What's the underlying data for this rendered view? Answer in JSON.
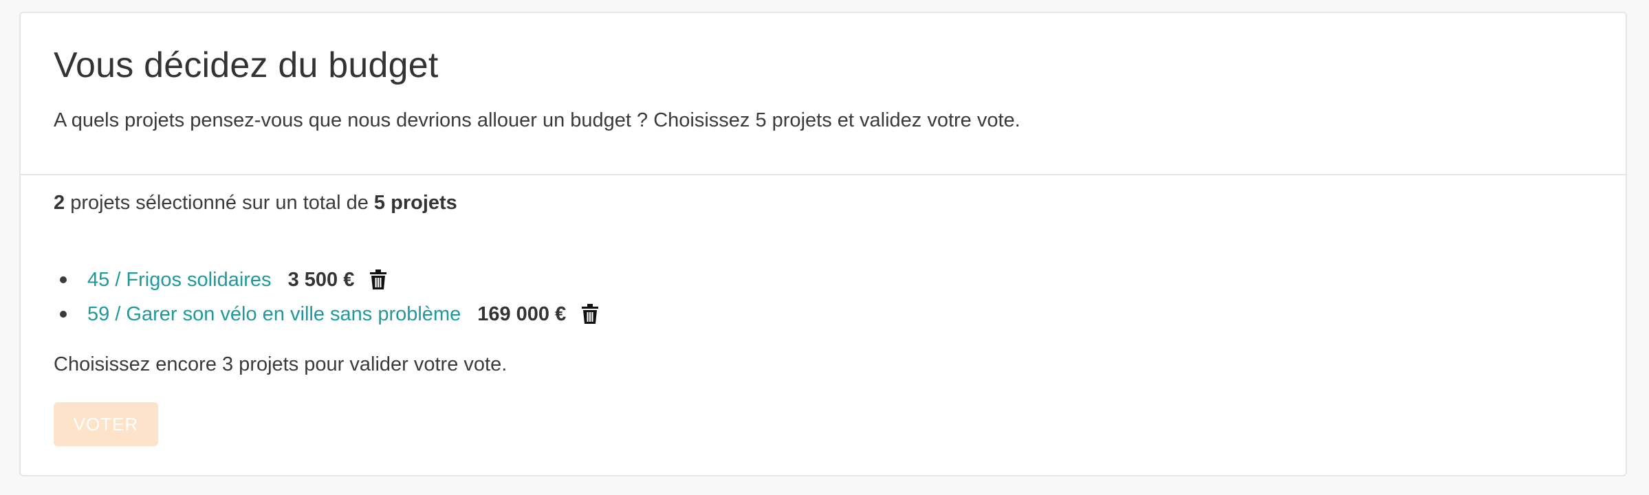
{
  "header": {
    "title": "Vous décidez du budget",
    "description": "A quels projets pensez-vous que nous devrions allouer un budget ? Choisissez 5 projets et validez votre vote."
  },
  "summary": {
    "selected_count": "2",
    "middle_text": " projets sélectionné sur un total de ",
    "total_text": "5 projets"
  },
  "projects": [
    {
      "label": "45 / Frigos solidaires",
      "amount": "3 500 €",
      "remove_icon": "trash-icon"
    },
    {
      "label": "59 / Garer son vélo en ville sans problème",
      "amount": "169 000 €",
      "remove_icon": "trash-icon"
    }
  ],
  "remaining_text": "Choisissez encore 3 projets pour valider votre vote.",
  "vote_button": {
    "label": "VOTER",
    "state": "disabled"
  },
  "colors": {
    "link": "#1e9a9a",
    "button_disabled_bg": "#fde3c9",
    "text": "#3a3a3a"
  }
}
